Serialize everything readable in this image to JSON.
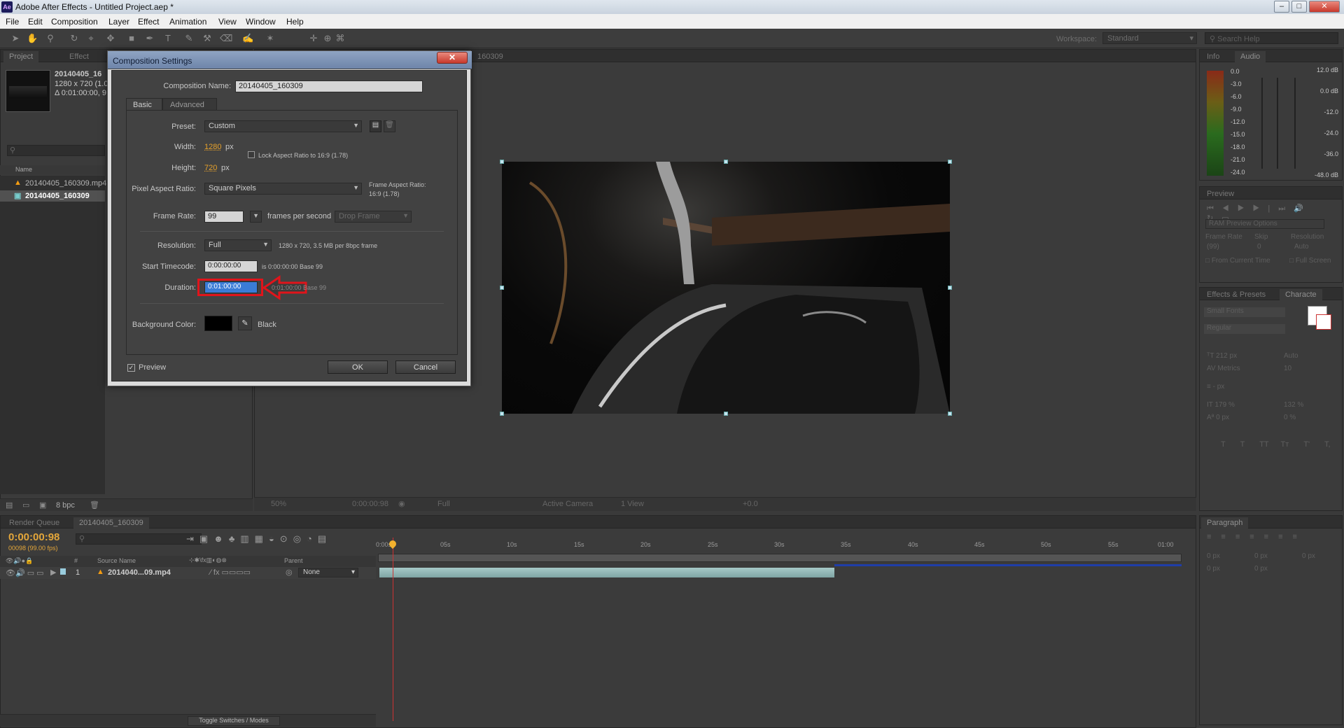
{
  "window": {
    "icon": "Ae",
    "title": "Adobe After Effects - Untitled Project.aep *",
    "minimize": "–",
    "maximize": "□",
    "close": "✕"
  },
  "menu": [
    "File",
    "Edit",
    "Composition",
    "Layer",
    "Effect",
    "Animation",
    "View",
    "Window",
    "Help"
  ],
  "toolbar": {
    "workspace_label": "Workspace:",
    "workspace_value": "Standard",
    "search_placeholder": "Search Help"
  },
  "project": {
    "tabs": [
      "Project",
      "Effect"
    ],
    "info_name": "20140405_16",
    "info_size": "1280 x 720 (1.0",
    "info_duration": "Δ 0:01:00:00, 9",
    "column_name": "Name",
    "items": [
      "20140405_160309.mp4",
      "20140405_160309"
    ],
    "bpc": "8 bpc"
  },
  "comp_viewer": {
    "tab": "160309",
    "zoom": "50%",
    "timecode": "0:00:00:98",
    "resolution": "Full",
    "camera": "Active Camera",
    "view": "1 View",
    "exposure": "+0.0"
  },
  "info_panel": {
    "tabs": [
      "Info",
      "Audio"
    ],
    "levels_left": [
      "0.0",
      "-3.0",
      "-6.0",
      "-9.0",
      "-12.0",
      "-15.0",
      "-18.0",
      "-21.0",
      "-24.0"
    ],
    "levels_right": [
      "12.0 dB",
      "0.0 dB",
      "-12.0",
      "-24.0",
      "-36.0",
      "-48.0 dB"
    ]
  },
  "preview_panel": {
    "tab": "Preview",
    "ram_options": "RAM Preview Options",
    "frame_rate": "Frame Rate",
    "skip": "Skip",
    "resolution": "Resolution",
    "fr_value": "(99)",
    "skip_value": "0",
    "res_value": "Auto",
    "from_current": "From Current Time",
    "full_screen": "Full Screen"
  },
  "character_panel": {
    "tabs": [
      "Effects & Presets",
      "Characte"
    ],
    "font": "Small Fonts",
    "style": "Regular",
    "size": "212 px",
    "leading": "Auto",
    "kerning": "Metrics",
    "tracking": "10",
    "stroke": "- px",
    "vscale": "179 %",
    "hscale": "132 %",
    "baseline": "0 px",
    "tsume": "0 %",
    "styles": [
      "T",
      "T",
      "TT",
      "Tт",
      "T'",
      "T,"
    ]
  },
  "paragraph_panel": {
    "tab": "Paragraph",
    "indent_values": [
      "0 px",
      "0 px",
      "0 px",
      "0 px",
      "0 px"
    ]
  },
  "timeline": {
    "tabs": [
      "Render Queue",
      "20140405_160309"
    ],
    "timecode": "0:00:00:98",
    "frame_fps": "00098 (99.00 fps)",
    "col_hash": "#",
    "col_source": "Source Name",
    "col_parent": "Parent",
    "layer_num": "1",
    "layer_name": "2014040...09.mp4",
    "layer_parent": "None",
    "toggle": "Toggle Switches / Modes",
    "ticks": [
      "0:00s",
      "05s",
      "10s",
      "15s",
      "20s",
      "25s",
      "30s",
      "35s",
      "40s",
      "45s",
      "50s",
      "55s",
      "01:00"
    ]
  },
  "dialog": {
    "title": "Composition Settings",
    "close": "✕",
    "comp_name_label": "Composition Name:",
    "comp_name": "20140405_160309",
    "tabs": [
      "Basic",
      "Advanced"
    ],
    "preset_label": "Preset:",
    "preset": "Custom",
    "width_label": "Width:",
    "width": "1280",
    "height_label": "Height:",
    "height": "720",
    "px": "px",
    "lock_aspect": "Lock Aspect Ratio to 16:9 (1.78)",
    "par_label": "Pixel Aspect Ratio:",
    "par": "Square Pixels",
    "frame_aspect": "Frame Aspect Ratio:",
    "frame_aspect_val": "16:9 (1.78)",
    "fr_label": "Frame Rate:",
    "fr": "99",
    "fps": "frames per second",
    "drop_frame": "Drop Frame",
    "res_label": "Resolution:",
    "res": "Full",
    "res_info": "1280 x 720, 3.5 MB per 8bpc frame",
    "start_label": "Start Timecode:",
    "start": "0:00:00:00",
    "start_info": "is 0:00:00:00  Base 99",
    "dur_label": "Duration:",
    "dur": "0:01:00:00",
    "dur_info": "0:01:00:00  Base 99",
    "bg_label": "Background Color:",
    "bg_name": "Black",
    "preview": "Preview",
    "ok": "OK",
    "cancel": "Cancel",
    "highlight_color": "#e0141b"
  }
}
